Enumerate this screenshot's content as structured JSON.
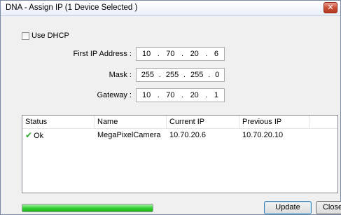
{
  "window": {
    "title": "DNA - Assign IP (1 Device Selected )",
    "close_glyph": "✕"
  },
  "dhcp": {
    "label": "Use DHCP",
    "checked": false
  },
  "fields": {
    "first_ip": {
      "label": "First IP Address :",
      "octets": [
        "10",
        "70",
        "20",
        "6"
      ]
    },
    "mask": {
      "label": "Mask :",
      "octets": [
        "255",
        "255",
        "255",
        "0"
      ]
    },
    "gateway": {
      "label": "Gateway :",
      "octets": [
        "10",
        "70",
        "20",
        "1"
      ]
    }
  },
  "list": {
    "columns": [
      "Status",
      "Name",
      "Current IP",
      "Previous IP",
      ""
    ],
    "rows": [
      {
        "status": "Ok",
        "status_icon": "check-icon",
        "name": "MegaPixelCamera",
        "current_ip": "10.70.20.6",
        "previous_ip": "10.70.20.10"
      }
    ]
  },
  "progress": {
    "value": 1.0,
    "color": "#2ec22e"
  },
  "buttons": {
    "update": "Update",
    "close": "Close"
  }
}
